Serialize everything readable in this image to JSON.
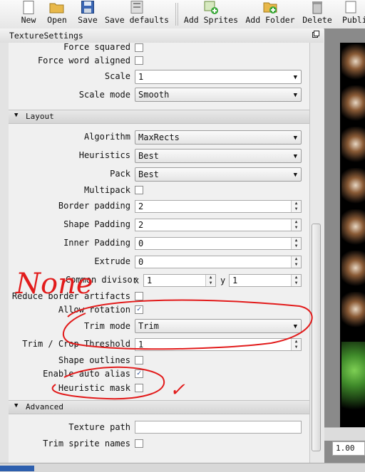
{
  "toolbar": {
    "new_label": "New",
    "open_label": "Open",
    "save_label": "Save",
    "save_defaults_label": "Save defaults",
    "add_sprites_label": "Add Sprites",
    "add_folder_label": "Add Folder",
    "delete_label": "Delete",
    "publish_label": "Publi"
  },
  "panel": {
    "title": "TextureSettings"
  },
  "settings": {
    "force_squared": {
      "label": "Force squared",
      "checked": false
    },
    "force_word_aligned": {
      "label": "Force word aligned",
      "checked": false
    },
    "scale": {
      "label": "Scale",
      "value": "1"
    },
    "scale_mode": {
      "label": "Scale mode",
      "value": "Smooth"
    },
    "layout_section": "Layout",
    "algorithm": {
      "label": "Algorithm",
      "value": "MaxRects"
    },
    "heuristics": {
      "label": "Heuristics",
      "value": "Best"
    },
    "pack": {
      "label": "Pack",
      "value": "Best"
    },
    "multipack": {
      "label": "Multipack",
      "checked": false
    },
    "border_padding": {
      "label": "Border padding",
      "value": "2"
    },
    "shape_padding": {
      "label": "Shape Padding",
      "value": "2"
    },
    "inner_padding": {
      "label": "Inner Padding",
      "value": "0"
    },
    "extrude": {
      "label": "Extrude",
      "value": "0"
    },
    "common_divisor": {
      "label": "Common divisor",
      "x_label": "x",
      "x_value": "1",
      "y_label": "y",
      "y_value": "1"
    },
    "reduce_border_artifacts": {
      "label": "Reduce border artifacts",
      "checked": false
    },
    "allow_rotation": {
      "label": "Allow rotation",
      "checked": true
    },
    "trim_mode": {
      "label": "Trim mode",
      "value": "Trim"
    },
    "trim_threshold": {
      "label": "Trim / Crop Threshold",
      "value": "1"
    },
    "shape_outlines": {
      "label": "Shape outlines",
      "checked": false
    },
    "enable_auto_alias": {
      "label": "Enable auto alias",
      "checked": true
    },
    "heuristic_mask": {
      "label": "Heuristic mask",
      "checked": false
    },
    "advanced_section": "Advanced",
    "texture_path": {
      "label": "Texture path",
      "value": ""
    },
    "trim_sprite_names": {
      "label": "Trim sprite names",
      "checked": false
    }
  },
  "preview": {
    "zoom": "1.00"
  },
  "annotations": {
    "handwriting": "None",
    "mark": "✓",
    "color": "#e21b1b"
  },
  "icons": {
    "combo": "chevron-down-icon",
    "check": "checkmark-icon",
    "spin": "spin-arrows-icon",
    "undock": "undock-icon"
  }
}
